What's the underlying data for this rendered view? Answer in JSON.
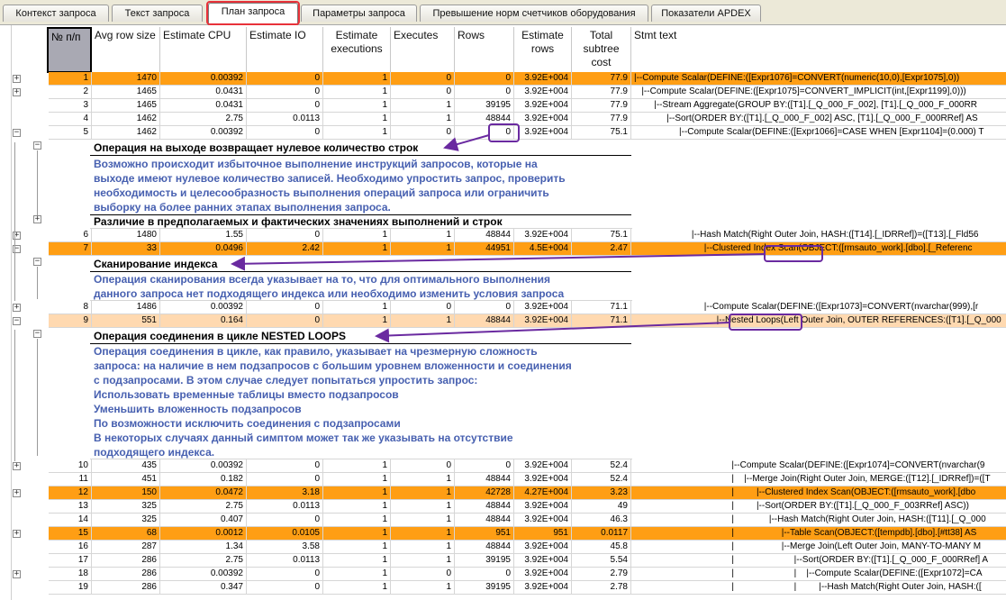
{
  "tabs": [
    "Контекст запроса",
    "Текст запроса",
    "План запроса",
    "Параметры запроса",
    "Превышение норм счетчиков оборудования",
    "Показатели APDEX"
  ],
  "columns": {
    "num": "№ п/п",
    "avg_row_size": "Avg row size",
    "est_cpu": "Estimate CPU",
    "est_io": "Estimate IO",
    "est_exec": "Estimate executions",
    "executes": "Executes",
    "rows": "Rows",
    "est_rows": "Estimate rows",
    "subtree": "Total subtree cost",
    "stmt": "Stmt text"
  },
  "rows": [
    {
      "n": "1",
      "avg": "1470",
      "cpu": "0.00392",
      "io": "0",
      "eexec": "1",
      "exec": "0",
      "rows": "0",
      "erows": "3.92E+004",
      "cost": "77.9",
      "stmt": "|--Compute Scalar(DEFINE:([Expr1076]=CONVERT(numeric(10,0),[Expr1075],0))"
    },
    {
      "n": "2",
      "avg": "1465",
      "cpu": "0.0431",
      "io": "0",
      "eexec": "1",
      "exec": "0",
      "rows": "0",
      "erows": "3.92E+004",
      "cost": "77.9",
      "stmt": "   |--Compute Scalar(DEFINE:([Expr1075]=CONVERT_IMPLICIT(int,[Expr1199],0)))"
    },
    {
      "n": "3",
      "avg": "1465",
      "cpu": "0.0431",
      "io": "0",
      "eexec": "1",
      "exec": "1",
      "rows": "39195",
      "erows": "3.92E+004",
      "cost": "77.9",
      "stmt": "        |--Stream Aggregate(GROUP BY:([T1].[_Q_000_F_002], [T1].[_Q_000_F_000RR"
    },
    {
      "n": "4",
      "avg": "1462",
      "cpu": "2.75",
      "io": "0.0113",
      "eexec": "1",
      "exec": "1",
      "rows": "48844",
      "erows": "3.92E+004",
      "cost": "77.9",
      "stmt": "             |--Sort(ORDER BY:([T1].[_Q_000_F_002] ASC, [T1].[_Q_000_F_000RRef] AS"
    },
    {
      "n": "5",
      "avg": "1462",
      "cpu": "0.00392",
      "io": "0",
      "eexec": "1",
      "exec": "0",
      "rows": "0",
      "erows": "3.92E+004",
      "cost": "75.1",
      "stmt": "                  |--Compute Scalar(DEFINE:([Expr1066]=CASE WHEN [Expr1104]=(0.000) T"
    },
    {
      "n": "6",
      "avg": "1480",
      "cpu": "1.55",
      "io": "0",
      "eexec": "1",
      "exec": "1",
      "rows": "48844",
      "erows": "3.92E+004",
      "cost": "75.1",
      "stmt": "                       |--Hash Match(Right Outer Join, HASH:([T14].[_IDRRef])=([T13].[_Fld56"
    },
    {
      "n": "7",
      "avg": "33",
      "cpu": "0.0496",
      "io": "2.42",
      "eexec": "1",
      "exec": "1",
      "rows": "44951",
      "erows": "4.5E+004",
      "cost": "2.47",
      "stmt": "                            |--Clustered Index Scan(OBJECT:([rmsauto_work].[dbo].[_Referenc"
    },
    {
      "n": "8",
      "avg": "1486",
      "cpu": "0.00392",
      "io": "0",
      "eexec": "1",
      "exec": "0",
      "rows": "0",
      "erows": "3.92E+004",
      "cost": "71.1",
      "stmt": "                            |--Compute Scalar(DEFINE:([Expr1073]=CONVERT(nvarchar(999),[r"
    },
    {
      "n": "9",
      "avg": "551",
      "cpu": "0.164",
      "io": "0",
      "eexec": "1",
      "exec": "1",
      "rows": "48844",
      "erows": "3.92E+004",
      "cost": "71.1",
      "stmt": "                                 |--Nested Loops(Left Outer Join, OUTER REFERENCES:([T1].[_Q_000"
    },
    {
      "n": "10",
      "avg": "435",
      "cpu": "0.00392",
      "io": "0",
      "eexec": "1",
      "exec": "0",
      "rows": "0",
      "erows": "3.92E+004",
      "cost": "52.4",
      "stmt": "                                       |--Compute Scalar(DEFINE:([Expr1074]=CONVERT(nvarchar(9"
    },
    {
      "n": "11",
      "avg": "451",
      "cpu": "0.182",
      "io": "0",
      "eexec": "1",
      "exec": "1",
      "rows": "48844",
      "erows": "3.92E+004",
      "cost": "52.4",
      "stmt": "                                       |    |--Merge Join(Right Outer Join, MERGE:([T12].[_IDRRef])=([T"
    },
    {
      "n": "12",
      "avg": "150",
      "cpu": "0.0472",
      "io": "3.18",
      "eexec": "1",
      "exec": "1",
      "rows": "42728",
      "erows": "4.27E+004",
      "cost": "3.23",
      "stmt": "                                       |         |--Clustered Index Scan(OBJECT:([rmsauto_work].[dbo"
    },
    {
      "n": "13",
      "avg": "325",
      "cpu": "2.75",
      "io": "0.0113",
      "eexec": "1",
      "exec": "1",
      "rows": "48844",
      "erows": "3.92E+004",
      "cost": "49",
      "stmt": "                                       |         |--Sort(ORDER BY:([T1].[_Q_000_F_003RRef] ASC))"
    },
    {
      "n": "14",
      "avg": "325",
      "cpu": "0.407",
      "io": "0",
      "eexec": "1",
      "exec": "1",
      "rows": "48844",
      "erows": "3.92E+004",
      "cost": "46.3",
      "stmt": "                                       |              |--Hash Match(Right Outer Join, HASH:([T11].[_Q_000"
    },
    {
      "n": "15",
      "avg": "68",
      "cpu": "0.0012",
      "io": "0.0105",
      "eexec": "1",
      "exec": "1",
      "rows": "951",
      "erows": "951",
      "cost": "0.0117",
      "stmt": "                                       |                   |--Table Scan(OBJECT:([tempdb].[dbo].[#tt38] AS"
    },
    {
      "n": "16",
      "avg": "287",
      "cpu": "1.34",
      "io": "3.58",
      "eexec": "1",
      "exec": "1",
      "rows": "48844",
      "erows": "3.92E+004",
      "cost": "45.8",
      "stmt": "                                       |                   |--Merge Join(Left Outer Join, MANY-TO-MANY M"
    },
    {
      "n": "17",
      "avg": "286",
      "cpu": "2.75",
      "io": "0.0113",
      "eexec": "1",
      "exec": "1",
      "rows": "39195",
      "erows": "3.92E+004",
      "cost": "5.54",
      "stmt": "                                       |                        |--Sort(ORDER BY:([T1].[_Q_000_F_000RRef] A"
    },
    {
      "n": "18",
      "avg": "286",
      "cpu": "0.00392",
      "io": "0",
      "eexec": "1",
      "exec": "0",
      "rows": "0",
      "erows": "3.92E+004",
      "cost": "2.79",
      "stmt": "                                       |                        |    |--Compute Scalar(DEFINE:([Expr1072]=CA"
    },
    {
      "n": "19",
      "avg": "286",
      "cpu": "0.347",
      "io": "0",
      "eexec": "1",
      "exec": "1",
      "rows": "39195",
      "erows": "3.92E+004",
      "cost": "2.78",
      "stmt": "                                       |                        |         |--Hash Match(Right Outer Join, HASH:(["
    }
  ],
  "details": {
    "zero_rows": {
      "title": "Операция на выходе возвращает нулевое количество строк",
      "lines": [
        "Возможно происходит избыточное выполнение инструкций запросов, которые на",
        "выходе имеют нулевое количество записей. Необходимо упростить запрос, проверить",
        "необходимость и целесообразность выполнения операций запроса или ограничить",
        "выборку на более ранних этапах выполнения запроса."
      ]
    },
    "mismatch": {
      "title": "Различие в предполагаемых и фактических значениях выполнений и строк"
    },
    "index_scan": {
      "title": "Сканирование индекса",
      "lines": [
        "Операция сканирования всегда указывает на то, что для оптимального выполнения",
        "данного запроса нет подходящего индекса или необходимо изменить условия запроса"
      ]
    },
    "nested_loops": {
      "title": "Операция соединения в цикле NESTED LOOPS",
      "lines": [
        "Операция соединения в цикле, как правило, указывает на чрезмерную сложность",
        "запроса: на наличие в нем подзапросов с большим уровнем вложенности и соединения",
        "с подзапросами. В этом случае следует попытаться упростить запрос:",
        "Использовать временные таблицы вместо подзапросов",
        "Уменьшить вложенность подзапросов",
        "По возможности исключить соединения с подзапросами",
        "В некоторых случаях данный симптом может так же указывать на отсутствие",
        "подходящего индекса."
      ]
    }
  },
  "colors": {
    "row_highlight": "#ff9e14",
    "row_selected": "#ffd9b0",
    "detail_text": "#4760b0",
    "annotation": "#6a2aa0",
    "tab_outline": "#e8323a"
  }
}
